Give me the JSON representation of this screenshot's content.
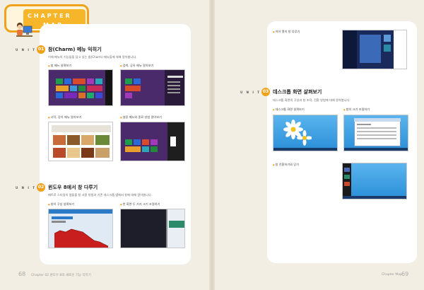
{
  "badge": {
    "word1": "CHAPTER",
    "word2": "MAP"
  },
  "units": [
    {
      "label": "U N I T",
      "num": "01",
      "title": "참(Charm) 메뉴 익히기",
      "desc": "이제 메뉴의 기능들을 담고 있는 참(Charm) 메뉴들에 대해 알아봅니다."
    },
    {
      "label": "U N I T",
      "num": "02",
      "title": "윈도우 8에서 창 다루기",
      "desc": "메트로 스타일의 앱들을 창 사용 방법과 기존 데스크톱 앱에서 창에 대해 알아봅니다."
    },
    {
      "label": "U N I T",
      "num": "03",
      "title": "데스크톱 화면 살펴보기",
      "desc": "데스크톱 화면의 구성과 창 조작, 전환 방법에 대해 알아봅니다."
    }
  ],
  "captions": {
    "c1": "참 메뉴 살펴보기",
    "c2": "검색, 공유 메뉴 알아보기",
    "c3": "시작, 장치 메뉴 알아보기",
    "c4": "설정 메뉴와 종료 방법 알아보기",
    "c5": "창의 구성 살펴보기",
    "c6": "한 화면 두 가지 크기 조절하기",
    "c7": "이어 열의 창 다루기",
    "c8": "데스크톱 화면 살펴보기",
    "c9": "창의 크기 조절하기",
    "c10": "창 전환하기와 닫기"
  },
  "footer": {
    "left_folio": "68",
    "left_text": "Chapter 02 윈도우 8의 새로운 기능 익히기",
    "right_text": "Chapter Map",
    "right_folio": "69"
  },
  "colors": {
    "accent": "#f0a21a",
    "metro_bg": "#4a2a6a",
    "desktop_sky": "#2a8fd8"
  }
}
